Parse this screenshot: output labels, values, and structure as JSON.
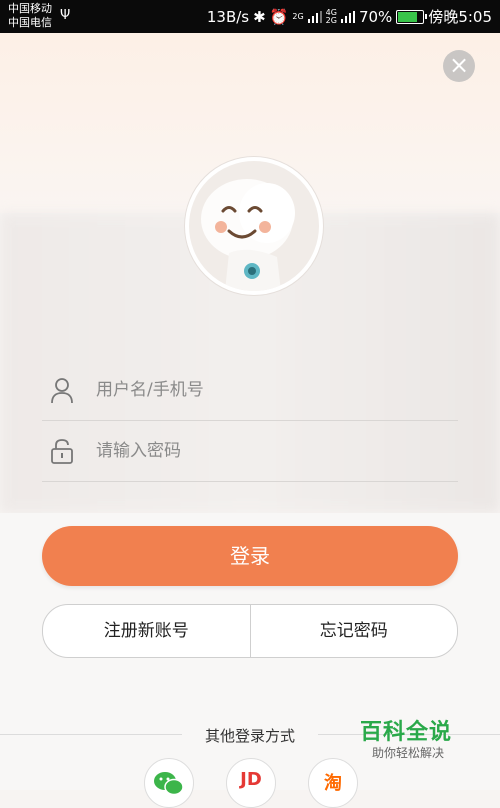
{
  "status_bar": {
    "carrier1": "中国移动",
    "carrier2": "中国电信",
    "speed": "13B/s",
    "net1": "2G",
    "net2": "4G",
    "net3": "2G",
    "battery": "70%",
    "time": "傍晚5:05"
  },
  "login": {
    "username_placeholder": "用户名/手机号",
    "password_placeholder": "请输入密码",
    "login_label": "登录",
    "register_label": "注册新账号",
    "forgot_label": "忘记密码"
  },
  "other": {
    "title": "其他登录方式",
    "jd": "JD",
    "taobao": "淘"
  },
  "watermark": {
    "brand": "百科全说",
    "slogan": "助你轻松解决"
  },
  "colors": {
    "accent": "#f1804f",
    "wechat": "#3cb54a",
    "jd": "#e53935",
    "taobao": "#ff6a00"
  }
}
